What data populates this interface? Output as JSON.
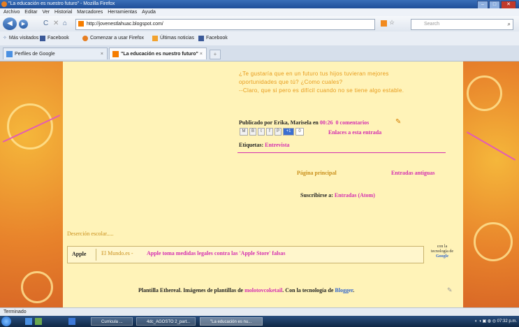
{
  "window": {
    "title": "\"La educación es nuestro futuro\" - Mozilla Firefox",
    "controls": [
      "–",
      "□",
      "✕"
    ]
  },
  "menubar": {
    "items": [
      "Archivo",
      "Editar",
      "Ver",
      "Historial",
      "Marcadores",
      "Herramientas",
      "Ayuda"
    ]
  },
  "navbar": {
    "back": "◀",
    "forward": "▶",
    "reload": "C",
    "stop": "✕",
    "home": "⌂",
    "url": "http://jovenestlahuac.blogspot.com/",
    "search_placeholder": "Search"
  },
  "bookmarks": {
    "items": [
      {
        "label": "Más visitados"
      },
      {
        "label": "Facebook"
      },
      {
        "label": "Comenzar a usar Firefox"
      },
      {
        "label": "Últimas noticias"
      },
      {
        "label": "Facebook"
      }
    ]
  },
  "tabs": [
    {
      "label": "Perfiles de Google",
      "close": "×"
    },
    {
      "label": "\"La educación es nuestro futuro\"",
      "close": "×"
    }
  ],
  "post": {
    "lines": [
      "¿Te gustaría que en un futuro tus hijos tuvieran mejores",
      "oportunidades que tú? ¿Como cuales?",
      "--Claro, que si pero es difícil cuando no se tiene algo estable."
    ],
    "byline_prefix": "Publicado por Erika, Marisela en",
    "time": "00:26",
    "comments": "0 comentarios",
    "share": [
      "M",
      "B",
      "t",
      "f",
      "P",
      "+1",
      "0"
    ],
    "enlaces": "Enlaces a esta entrada",
    "etiquetas_label": "Etiquetas:",
    "etiqueta": "Entrevista"
  },
  "pager": {
    "home": "Página principal",
    "older": "Entradas antiguas"
  },
  "subscribe": {
    "label": "Suscribirse a:",
    "link": "Entradas (Atom)"
  },
  "sidebar_link": "Deserción escolar.....",
  "feed": {
    "keyword": "Apple",
    "source": "El Mundo.es -",
    "headline": "Apple toma medidas legales contra las 'Apple Store' falsas"
  },
  "google_badge": {
    "line1": "con la",
    "line2": "tecnología de",
    "brand": "Google"
  },
  "footer": {
    "prefix": "Plantilla Ethereal. Imágenes de plantillas de",
    "link1": "molotovcoketail",
    "middle": ". Con la tecnología de",
    "link2": "Blogger",
    "suffix": "."
  },
  "status": "Terminado",
  "taskbar": {
    "items": [
      "Curricula ...",
      "4dc_AGOSTO 2_part...",
      "\"La educación es nu..."
    ],
    "clock": "07:32 p.m."
  },
  "colors": {
    "pink": "#d42eb0",
    "orange_text": "#e79b1c",
    "page_bg": "#fff3b8"
  }
}
